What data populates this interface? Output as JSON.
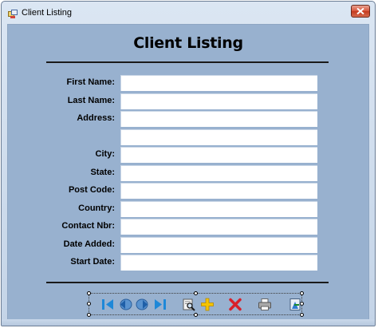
{
  "window": {
    "title": "Client Listing",
    "close_glyph": "close-icon"
  },
  "form": {
    "heading": "Client Listing",
    "fields": [
      {
        "label": "First Name:",
        "value": ""
      },
      {
        "label": "Last Name:",
        "value": ""
      },
      {
        "label": "Address:",
        "value": ""
      },
      {
        "label": "",
        "value": ""
      },
      {
        "label": "City:",
        "value": ""
      },
      {
        "label": "State:",
        "value": ""
      },
      {
        "label": "Post Code:",
        "value": ""
      },
      {
        "label": "Country:",
        "value": ""
      },
      {
        "label": "Contact Nbr:",
        "value": ""
      },
      {
        "label": "Date Added:",
        "value": ""
      },
      {
        "label": "Start Date:",
        "value": ""
      }
    ]
  },
  "toolbar": {
    "buttons": [
      {
        "name": "first-record-icon"
      },
      {
        "name": "previous-record-icon"
      },
      {
        "name": "next-record-icon"
      },
      {
        "name": "last-record-icon"
      },
      {
        "name": "find-record-icon"
      },
      {
        "name": "add-record-icon"
      },
      {
        "name": "delete-record-icon"
      },
      {
        "name": "print-icon"
      },
      {
        "name": "exit-icon"
      }
    ]
  },
  "colors": {
    "form_background": "#98b1cf",
    "window_frame": "#c4d4e7",
    "close_button": "#c43a1f",
    "nav_blue": "#1e88d8",
    "add_yellow": "#f5c400",
    "delete_red": "#d8202a"
  }
}
